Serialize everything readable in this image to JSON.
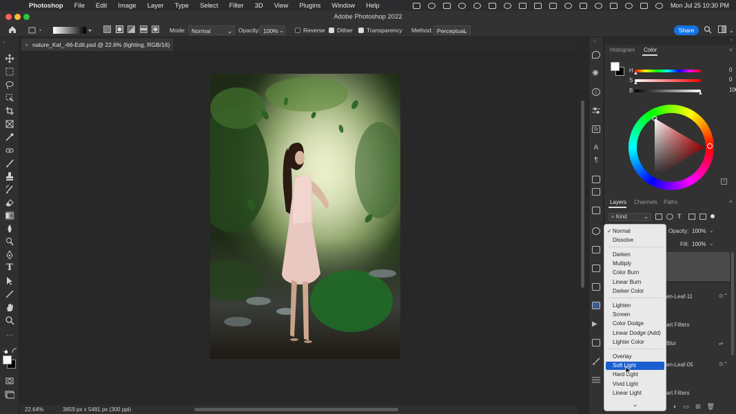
{
  "menubar": {
    "app": "Photoshop",
    "items": [
      "File",
      "Edit",
      "Image",
      "Layer",
      "Type",
      "Select",
      "Filter",
      "3D",
      "View",
      "Plugins",
      "Window",
      "Help"
    ],
    "clock": "Mon Jul 25  10:30 PM"
  },
  "window": {
    "title": "Adobe Photoshop 2022"
  },
  "options": {
    "mode_label": "Mode:",
    "mode_value": "Normal",
    "opacity_label": "Opacity:",
    "opacity_value": "100%",
    "reverse_label": "Reverse",
    "reverse_checked": false,
    "dither_label": "Dither",
    "dither_checked": true,
    "transparency_label": "Transparency",
    "transparency_checked": true,
    "method_label": "Method:",
    "method_value": "Perceptual",
    "share_label": "Share"
  },
  "document": {
    "tab_title": "nature_Kat_-66-Edit.psd @ 22.6% (lighting, RGB/16) *",
    "close_glyph": "×"
  },
  "status": {
    "zoom": "22.64%",
    "info": "3659 px x 5481 px (300 ppi)"
  },
  "panels": {
    "top_tabs": [
      "Histogram",
      "Color"
    ],
    "active_top_tab": "Color",
    "color": {
      "h_label": "H",
      "h_value": "0",
      "h_unit": "°",
      "s_label": "S",
      "s_value": "0",
      "s_unit": "%",
      "b_label": "B",
      "b_value": "100",
      "b_unit": "%"
    },
    "layer_tabs": [
      "Layers",
      "Channels",
      "Paths"
    ],
    "active_layer_tab": "Layers",
    "kind_label": "Kind",
    "opacity_label": "Opacity:",
    "opacity_value": "100%",
    "fill_label": "Fill:",
    "fill_value": "100%",
    "layer_fragments": [
      "en-Leaf-11",
      "art Filters",
      "Blur",
      "en-Leaf-05",
      "art Filters"
    ]
  },
  "blend_dropdown": {
    "groups": [
      [
        "Normal",
        "Dissolve"
      ],
      [
        "Darken",
        "Multiply",
        "Color Burn",
        "Linear Burn",
        "Darker Color"
      ],
      [
        "Lighten",
        "Screen",
        "Color Dodge",
        "Linear Dodge (Add)",
        "Lighter Color"
      ],
      [
        "Overlay",
        "Soft Light",
        "Hard Light",
        "Vivid Light",
        "Linear Light"
      ]
    ],
    "checked": "Normal",
    "highlighted": "Soft Light",
    "more_glyph": "⌄"
  },
  "colors": {
    "accent": "#1473e6",
    "dropdown_highlight": "#1a5fd0",
    "panel_bg": "#323232",
    "canvas_bg": "#282828"
  }
}
